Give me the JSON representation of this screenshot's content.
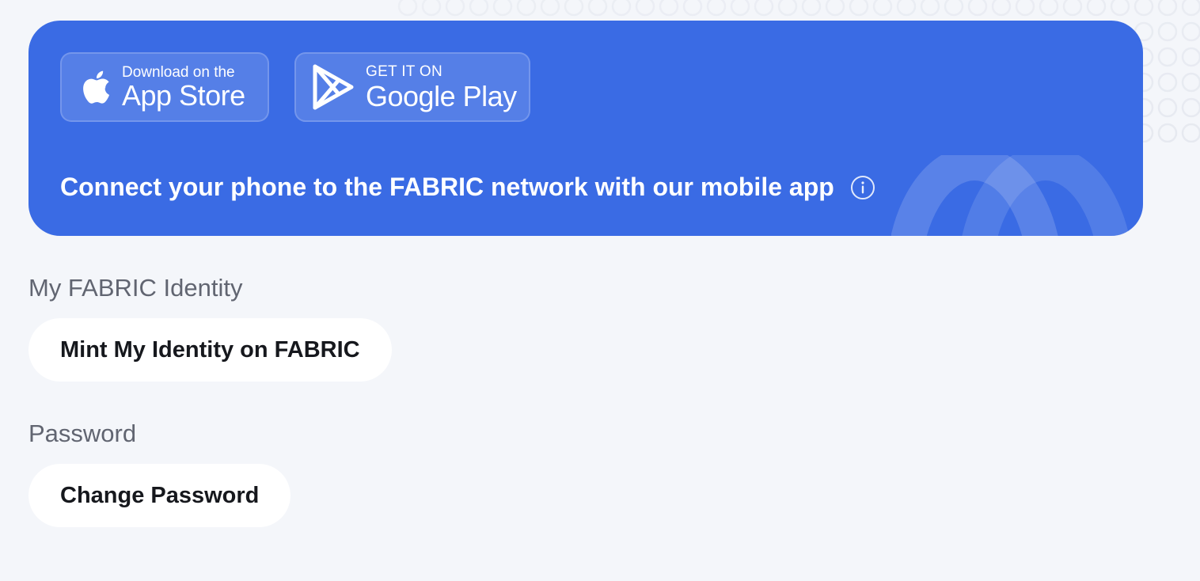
{
  "app_banner": {
    "app_store": {
      "small_label": "Download on the",
      "big_label": "App Store",
      "icon": "apple-icon"
    },
    "google_play": {
      "small_label": "GET IT ON",
      "big_label": "Google Play",
      "icon": "google-play-icon"
    },
    "description": "Connect your phone to the FABRIC network with our mobile app",
    "info_icon": "info-icon",
    "background_color": "#3a6be4"
  },
  "identity_section": {
    "label": "My FABRIC Identity",
    "button_label": "Mint My Identity on FABRIC"
  },
  "password_section": {
    "label": "Password",
    "button_label": "Change Password"
  }
}
